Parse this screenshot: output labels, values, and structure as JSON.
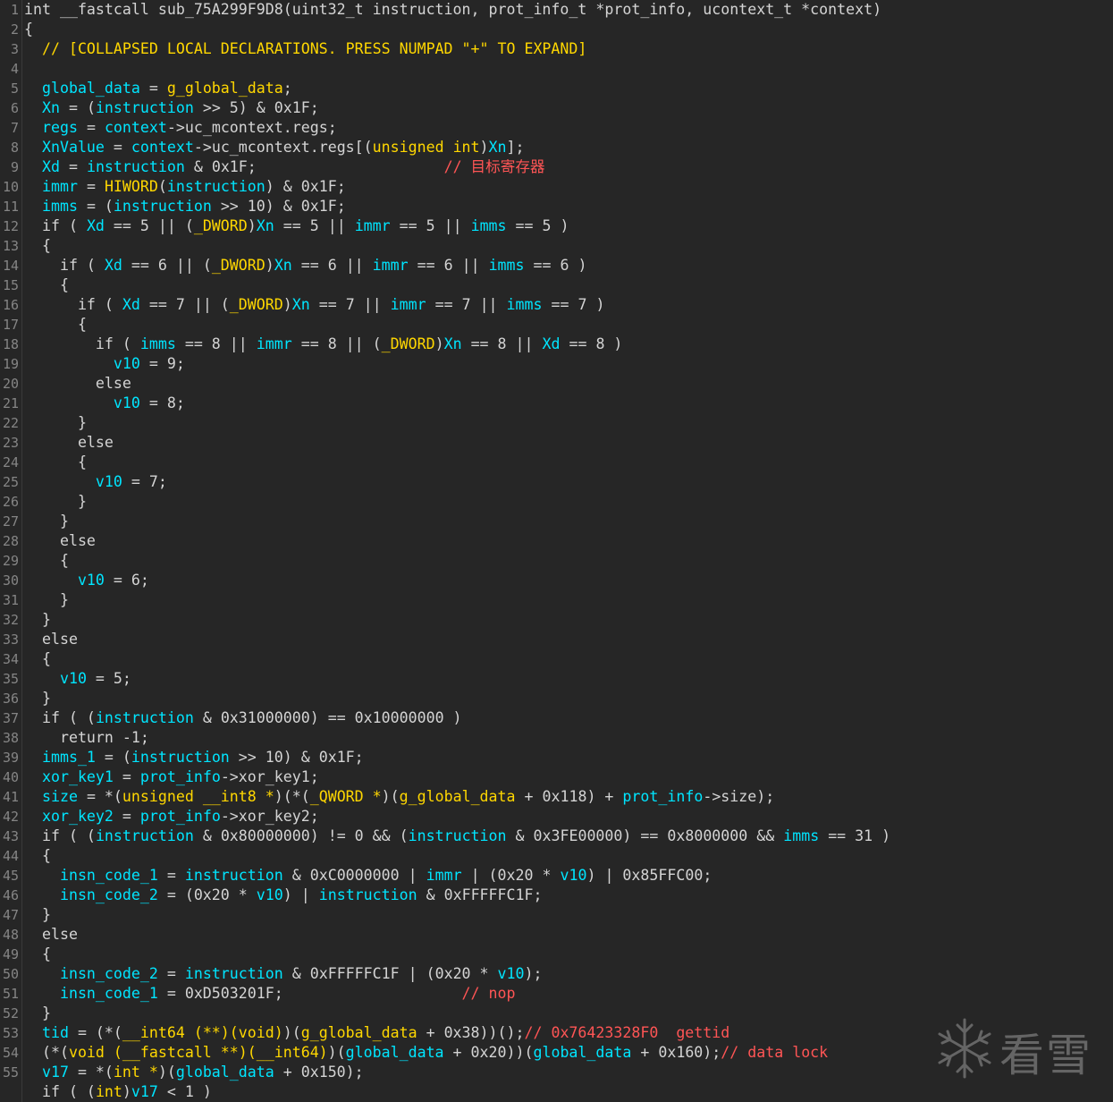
{
  "watermark": {
    "text": "看雪",
    "icon": "snowflake-icon"
  },
  "colors": {
    "background": "#262626",
    "default": "#d4d4d4",
    "variable": "#00e5ff",
    "type": "#ffd700",
    "comment": "#ff5555",
    "line_number": "#858585"
  },
  "lines": [
    {
      "n": "1",
      "s": [
        [
          "d",
          "int __fastcall sub_75A299F9D8(uint32_t instruction, prot_info_t *prot_info, ucontext_t *context)"
        ]
      ]
    },
    {
      "n": "2",
      "s": [
        [
          "d",
          "{"
        ]
      ]
    },
    {
      "n": "3",
      "s": [
        [
          "y",
          "  // [COLLAPSED LOCAL DECLARATIONS. PRESS NUMPAD \"+\" TO EXPAND]"
        ]
      ]
    },
    {
      "n": "4",
      "s": []
    },
    {
      "n": "5",
      "s": [
        [
          "v",
          "  global_data"
        ],
        [
          "d",
          " = "
        ],
        [
          "y",
          "g_global_data"
        ],
        [
          "d",
          ";"
        ]
      ]
    },
    {
      "n": "6",
      "s": [
        [
          "v",
          "  Xn"
        ],
        [
          "d",
          " = ("
        ],
        [
          "v",
          "instruction"
        ],
        [
          "d",
          " >> 5) & 0x1F;"
        ]
      ]
    },
    {
      "n": "7",
      "s": [
        [
          "v",
          "  regs"
        ],
        [
          "d",
          " = "
        ],
        [
          "v",
          "context"
        ],
        [
          "d",
          "->uc_mcontext.regs;"
        ]
      ]
    },
    {
      "n": "8",
      "s": [
        [
          "v",
          "  XnValue"
        ],
        [
          "d",
          " = "
        ],
        [
          "v",
          "context"
        ],
        [
          "d",
          "->uc_mcontext.regs[("
        ],
        [
          "y",
          "unsigned int"
        ],
        [
          "d",
          ")"
        ],
        [
          "v",
          "Xn"
        ],
        [
          "d",
          "];"
        ]
      ]
    },
    {
      "n": "9",
      "s": [
        [
          "v",
          "  Xd"
        ],
        [
          "d",
          " = "
        ],
        [
          "v",
          "instruction"
        ],
        [
          "d",
          " & 0x1F;                     "
        ],
        [
          "c",
          "// 目标寄存器"
        ]
      ]
    },
    {
      "n": "10",
      "s": [
        [
          "v",
          "  immr"
        ],
        [
          "d",
          " = "
        ],
        [
          "y",
          "HIWORD"
        ],
        [
          "d",
          "("
        ],
        [
          "v",
          "instruction"
        ],
        [
          "d",
          ") & 0x1F;"
        ]
      ]
    },
    {
      "n": "11",
      "s": [
        [
          "v",
          "  imms"
        ],
        [
          "d",
          " = ("
        ],
        [
          "v",
          "instruction"
        ],
        [
          "d",
          " >> 10) & 0x1F;"
        ]
      ]
    },
    {
      "n": "12",
      "s": [
        [
          "d",
          "  if ( "
        ],
        [
          "v",
          "Xd"
        ],
        [
          "d",
          " == 5 || ("
        ],
        [
          "y",
          "_DWORD"
        ],
        [
          "d",
          ")"
        ],
        [
          "v",
          "Xn"
        ],
        [
          "d",
          " == 5 || "
        ],
        [
          "v",
          "immr"
        ],
        [
          "d",
          " == 5 || "
        ],
        [
          "v",
          "imms"
        ],
        [
          "d",
          " == 5 )"
        ]
      ]
    },
    {
      "n": "13",
      "s": [
        [
          "d",
          "  {"
        ]
      ]
    },
    {
      "n": "14",
      "s": [
        [
          "d",
          "    if ( "
        ],
        [
          "v",
          "Xd"
        ],
        [
          "d",
          " == 6 || ("
        ],
        [
          "y",
          "_DWORD"
        ],
        [
          "d",
          ")"
        ],
        [
          "v",
          "Xn"
        ],
        [
          "d",
          " == 6 || "
        ],
        [
          "v",
          "immr"
        ],
        [
          "d",
          " == 6 || "
        ],
        [
          "v",
          "imms"
        ],
        [
          "d",
          " == 6 )"
        ]
      ]
    },
    {
      "n": "15",
      "s": [
        [
          "d",
          "    {"
        ]
      ]
    },
    {
      "n": "16",
      "s": [
        [
          "d",
          "      if ( "
        ],
        [
          "v",
          "Xd"
        ],
        [
          "d",
          " == 7 || ("
        ],
        [
          "y",
          "_DWORD"
        ],
        [
          "d",
          ")"
        ],
        [
          "v",
          "Xn"
        ],
        [
          "d",
          " == 7 || "
        ],
        [
          "v",
          "immr"
        ],
        [
          "d",
          " == 7 || "
        ],
        [
          "v",
          "imms"
        ],
        [
          "d",
          " == 7 )"
        ]
      ]
    },
    {
      "n": "17",
      "s": [
        [
          "d",
          "      {"
        ]
      ]
    },
    {
      "n": "18",
      "s": [
        [
          "d",
          "        if ( "
        ],
        [
          "v",
          "imms"
        ],
        [
          "d",
          " == 8 || "
        ],
        [
          "v",
          "immr"
        ],
        [
          "d",
          " == 8 || ("
        ],
        [
          "y",
          "_DWORD"
        ],
        [
          "d",
          ")"
        ],
        [
          "v",
          "Xn"
        ],
        [
          "d",
          " == 8 || "
        ],
        [
          "v",
          "Xd"
        ],
        [
          "d",
          " == 8 )"
        ]
      ]
    },
    {
      "n": "19",
      "s": [
        [
          "v",
          "          v10"
        ],
        [
          "d",
          " = 9;"
        ]
      ]
    },
    {
      "n": "20",
      "s": [
        [
          "d",
          "        else"
        ]
      ]
    },
    {
      "n": "21",
      "s": [
        [
          "v",
          "          v10"
        ],
        [
          "d",
          " = 8;"
        ]
      ]
    },
    {
      "n": "22",
      "s": [
        [
          "d",
          "      }"
        ]
      ]
    },
    {
      "n": "23",
      "s": [
        [
          "d",
          "      else"
        ]
      ]
    },
    {
      "n": "24",
      "s": [
        [
          "d",
          "      {"
        ]
      ]
    },
    {
      "n": "25",
      "s": [
        [
          "v",
          "        v10"
        ],
        [
          "d",
          " = 7;"
        ]
      ]
    },
    {
      "n": "26",
      "s": [
        [
          "d",
          "      }"
        ]
      ]
    },
    {
      "n": "27",
      "s": [
        [
          "d",
          "    }"
        ]
      ]
    },
    {
      "n": "28",
      "s": [
        [
          "d",
          "    else"
        ]
      ]
    },
    {
      "n": "29",
      "s": [
        [
          "d",
          "    {"
        ]
      ]
    },
    {
      "n": "30",
      "s": [
        [
          "v",
          "      v10"
        ],
        [
          "d",
          " = 6;"
        ]
      ]
    },
    {
      "n": "31",
      "s": [
        [
          "d",
          "    }"
        ]
      ]
    },
    {
      "n": "32",
      "s": [
        [
          "d",
          "  }"
        ]
      ]
    },
    {
      "n": "33",
      "s": [
        [
          "d",
          "  else"
        ]
      ]
    },
    {
      "n": "34",
      "s": [
        [
          "d",
          "  {"
        ]
      ]
    },
    {
      "n": "35",
      "s": [
        [
          "v",
          "    v10"
        ],
        [
          "d",
          " = 5;"
        ]
      ]
    },
    {
      "n": "36",
      "s": [
        [
          "d",
          "  }"
        ]
      ]
    },
    {
      "n": "37",
      "s": [
        [
          "d",
          "  if ( ("
        ],
        [
          "v",
          "instruction"
        ],
        [
          "d",
          " & 0x31000000) == 0x10000000 )"
        ]
      ]
    },
    {
      "n": "38",
      "s": [
        [
          "d",
          "    return -1;"
        ]
      ]
    },
    {
      "n": "39",
      "s": [
        [
          "v",
          "  imms_1"
        ],
        [
          "d",
          " = ("
        ],
        [
          "v",
          "instruction"
        ],
        [
          "d",
          " >> 10) & 0x1F;"
        ]
      ]
    },
    {
      "n": "40",
      "s": [
        [
          "v",
          "  xor_key1"
        ],
        [
          "d",
          " = "
        ],
        [
          "v",
          "prot_info"
        ],
        [
          "d",
          "->xor_key1;"
        ]
      ]
    },
    {
      "n": "41",
      "s": [
        [
          "v",
          "  size"
        ],
        [
          "d",
          " = *("
        ],
        [
          "y",
          "unsigned __int8 *"
        ],
        [
          "d",
          ")(*("
        ],
        [
          "y",
          "_QWORD *"
        ],
        [
          "d",
          ")("
        ],
        [
          "y",
          "g_global_data"
        ],
        [
          "d",
          " + 0x118) + "
        ],
        [
          "v",
          "prot_info"
        ],
        [
          "d",
          "->size);"
        ]
      ]
    },
    {
      "n": "42",
      "s": [
        [
          "v",
          "  xor_key2"
        ],
        [
          "d",
          " = "
        ],
        [
          "v",
          "prot_info"
        ],
        [
          "d",
          "->xor_key2;"
        ]
      ]
    },
    {
      "n": "43",
      "s": [
        [
          "d",
          "  if ( ("
        ],
        [
          "v",
          "instruction"
        ],
        [
          "d",
          " & 0x80000000) != 0 && ("
        ],
        [
          "v",
          "instruction"
        ],
        [
          "d",
          " & 0x3FE00000) == 0x8000000 && "
        ],
        [
          "v",
          "imms"
        ],
        [
          "d",
          " == 31 )"
        ]
      ]
    },
    {
      "n": "44",
      "s": [
        [
          "d",
          "  {"
        ]
      ]
    },
    {
      "n": "45",
      "s": [
        [
          "v",
          "    insn_code_1"
        ],
        [
          "d",
          " = "
        ],
        [
          "v",
          "instruction"
        ],
        [
          "d",
          " & 0xC0000000 | "
        ],
        [
          "v",
          "immr"
        ],
        [
          "d",
          " | (0x20 * "
        ],
        [
          "v",
          "v10"
        ],
        [
          "d",
          ") | 0x85FFC00;"
        ]
      ]
    },
    {
      "n": "46",
      "s": [
        [
          "v",
          "    insn_code_2"
        ],
        [
          "d",
          " = (0x20 * "
        ],
        [
          "v",
          "v10"
        ],
        [
          "d",
          ") | "
        ],
        [
          "v",
          "instruction"
        ],
        [
          "d",
          " & 0xFFFFFC1F;"
        ]
      ]
    },
    {
      "n": "47",
      "s": [
        [
          "d",
          "  }"
        ]
      ]
    },
    {
      "n": "48",
      "s": [
        [
          "d",
          "  else"
        ]
      ]
    },
    {
      "n": "49",
      "s": [
        [
          "d",
          "  {"
        ]
      ]
    },
    {
      "n": "50",
      "s": [
        [
          "v",
          "    insn_code_2"
        ],
        [
          "d",
          " = "
        ],
        [
          "v",
          "instruction"
        ],
        [
          "d",
          " & 0xFFFFFC1F | (0x20 * "
        ],
        [
          "v",
          "v10"
        ],
        [
          "d",
          ");"
        ]
      ]
    },
    {
      "n": "51",
      "s": [
        [
          "v",
          "    insn_code_1"
        ],
        [
          "d",
          " = 0xD503201F;                    "
        ],
        [
          "c",
          "// nop"
        ]
      ]
    },
    {
      "n": "52",
      "s": [
        [
          "d",
          "  }"
        ]
      ]
    },
    {
      "n": "53",
      "s": [
        [
          "v",
          "  tid"
        ],
        [
          "d",
          " = (*("
        ],
        [
          "y",
          "__int64 (**)(void)"
        ],
        [
          "d",
          ")("
        ],
        [
          "y",
          "g_global_data"
        ],
        [
          "d",
          " + 0x38))();"
        ],
        [
          "c",
          "// 0x76423328F0  gettid"
        ]
      ]
    },
    {
      "n": "54",
      "s": [
        [
          "d",
          "  (*("
        ],
        [
          "y",
          "void (__fastcall **)(__int64)"
        ],
        [
          "d",
          ")("
        ],
        [
          "v",
          "global_data"
        ],
        [
          "d",
          " + 0x20))("
        ],
        [
          "v",
          "global_data"
        ],
        [
          "d",
          " + 0x160);"
        ],
        [
          "c",
          "// data lock"
        ]
      ]
    },
    {
      "n": "55",
      "s": [
        [
          "v",
          "  v17"
        ],
        [
          "d",
          " = *("
        ],
        [
          "y",
          "int *"
        ],
        [
          "d",
          ")("
        ],
        [
          "v",
          "global_data"
        ],
        [
          "d",
          " + 0x150);"
        ]
      ]
    },
    {
      "n": "",
      "s": [
        [
          "d",
          "  if ( ("
        ],
        [
          "y",
          "int"
        ],
        [
          "d",
          ")"
        ],
        [
          "v",
          "v17"
        ],
        [
          "d",
          " < 1 )"
        ]
      ]
    }
  ]
}
